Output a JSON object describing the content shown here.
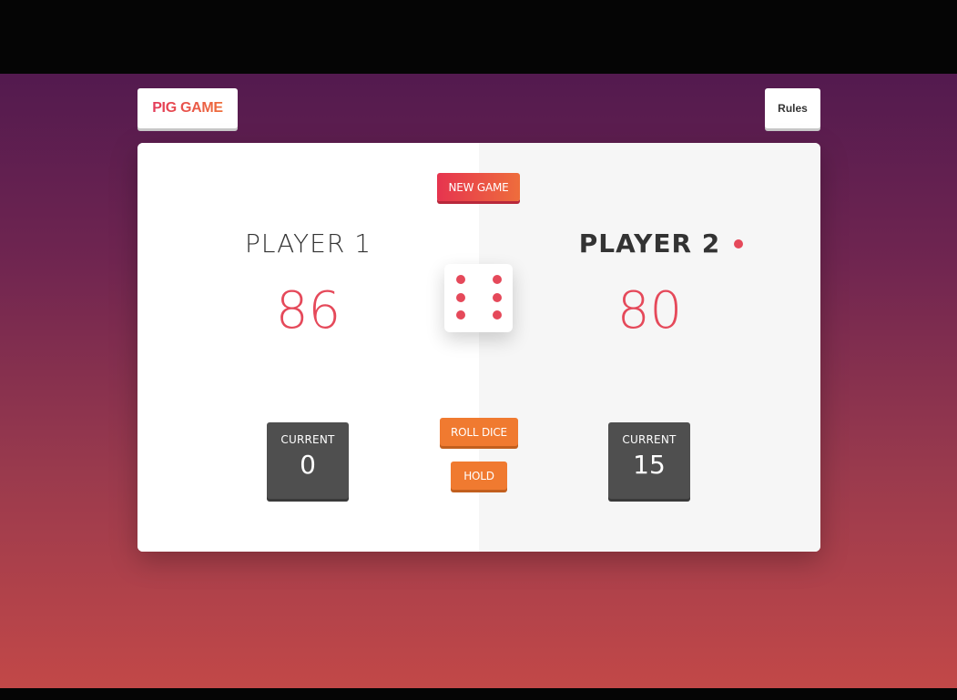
{
  "header": {
    "logo_label": "PIG GAME",
    "rules_label": "Rules"
  },
  "controls": {
    "new_game_label": "NEW GAME",
    "roll_dice_label": "ROLL DICE",
    "hold_label": "HOLD"
  },
  "players": [
    {
      "name": "PLAYER 1",
      "score": "86",
      "current_label": "CURRENT",
      "current_value": "0",
      "active": false
    },
    {
      "name": "PLAYER 2",
      "score": "80",
      "current_label": "CURRENT",
      "current_value": "15",
      "active": true
    }
  ],
  "dice": {
    "value": 6,
    "icon": "dice-six-icon"
  },
  "colors": {
    "accent_red": "#e5495a",
    "accent_orange": "#f07a30",
    "current_box": "#4f4f4f",
    "background_top": "#531a4f",
    "background_bottom": "#c24848"
  }
}
